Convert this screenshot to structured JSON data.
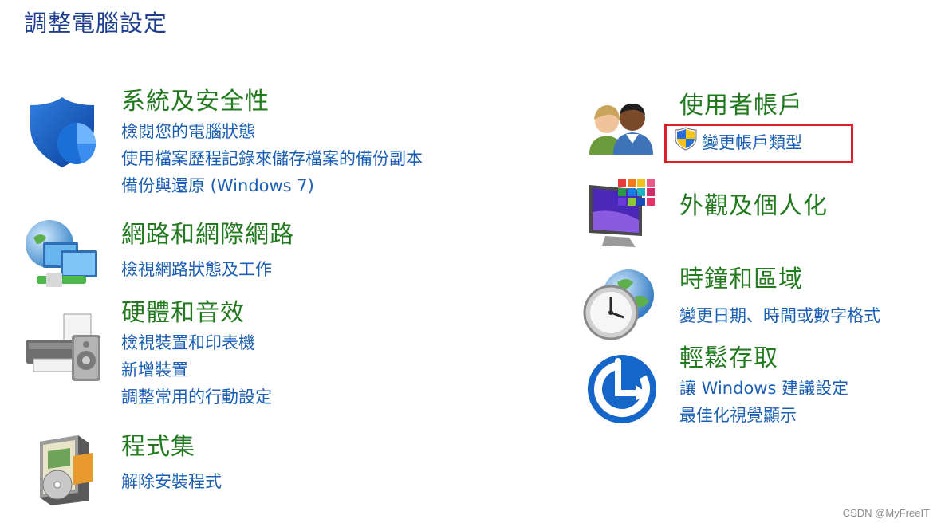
{
  "page_title": "調整電腦設定",
  "colors": {
    "title": "#1e3f8f",
    "category": "#227a1e",
    "link": "#1a5fb4",
    "highlight": "#e0202a"
  },
  "left": [
    {
      "icon": "security-shield-icon",
      "title": "系統及安全性",
      "links": [
        "檢閱您的電腦狀態",
        "使用檔案歷程記錄來儲存檔案的備份副本",
        "備份與還原 (Windows 7)"
      ]
    },
    {
      "icon": "network-globe-icon",
      "title": "網路和網際網路",
      "links": [
        "檢視網路狀態及工作"
      ]
    },
    {
      "icon": "printer-speaker-icon",
      "title": "硬體和音效",
      "links": [
        "檢視裝置和印表機",
        "新增裝置",
        "調整常用的行動設定"
      ]
    },
    {
      "icon": "programs-box-icon",
      "title": "程式集",
      "links": [
        "解除安裝程式"
      ]
    }
  ],
  "right": [
    {
      "icon": "user-accounts-icon",
      "title": "使用者帳戶",
      "links": [
        "變更帳戶類型"
      ],
      "link_icon": "uac-shield-icon"
    },
    {
      "icon": "appearance-monitor-icon",
      "title": "外觀及個人化",
      "links": []
    },
    {
      "icon": "globe-clock-icon",
      "title": "時鐘和區域",
      "links": [
        "變更日期、時間或數字格式"
      ]
    },
    {
      "icon": "ease-of-access-icon",
      "title": "輕鬆存取",
      "links": [
        "讓 Windows 建議設定",
        "最佳化視覺顯示"
      ]
    }
  ],
  "watermark": "CSDN @MyFreeIT"
}
